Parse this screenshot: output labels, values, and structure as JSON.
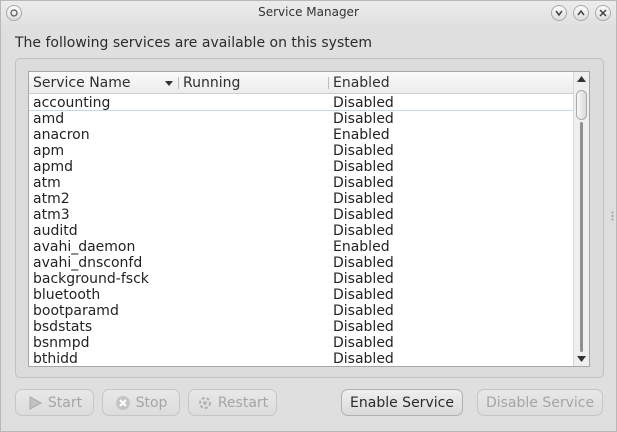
{
  "window": {
    "title": "Service Manager"
  },
  "heading": "The following services are available on this system",
  "table": {
    "columns": [
      "Service Name",
      "Running",
      "Enabled"
    ],
    "rows": [
      {
        "name": "accounting",
        "running": "",
        "enabled": "Disabled"
      },
      {
        "name": "amd",
        "running": "",
        "enabled": "Disabled"
      },
      {
        "name": "anacron",
        "running": "",
        "enabled": "Enabled"
      },
      {
        "name": "apm",
        "running": "",
        "enabled": "Disabled"
      },
      {
        "name": "apmd",
        "running": "",
        "enabled": "Disabled"
      },
      {
        "name": "atm",
        "running": "",
        "enabled": "Disabled"
      },
      {
        "name": "atm2",
        "running": "",
        "enabled": "Disabled"
      },
      {
        "name": "atm3",
        "running": "",
        "enabled": "Disabled"
      },
      {
        "name": "auditd",
        "running": "",
        "enabled": "Disabled"
      },
      {
        "name": "avahi_daemon",
        "running": "",
        "enabled": "Enabled"
      },
      {
        "name": "avahi_dnsconfd",
        "running": "",
        "enabled": "Disabled"
      },
      {
        "name": "background-fsck",
        "running": "",
        "enabled": "Disabled"
      },
      {
        "name": "bluetooth",
        "running": "",
        "enabled": "Disabled"
      },
      {
        "name": "bootparamd",
        "running": "",
        "enabled": "Disabled"
      },
      {
        "name": "bsdstats",
        "running": "",
        "enabled": "Disabled"
      },
      {
        "name": "bsnmpd",
        "running": "",
        "enabled": "Disabled"
      },
      {
        "name": "bthidd",
        "running": "",
        "enabled": "Disabled"
      }
    ]
  },
  "buttons": {
    "start": "Start",
    "stop": "Stop",
    "restart": "Restart",
    "enable": "Enable Service",
    "disable": "Disable Service"
  },
  "icons": {
    "window_menu": "circle-icon",
    "minimize": "chevron-down-icon",
    "maximize": "chevron-up-icon",
    "close": "close-icon",
    "start": "play-icon",
    "stop": "stop-icon",
    "restart": "gear-refresh-icon"
  }
}
